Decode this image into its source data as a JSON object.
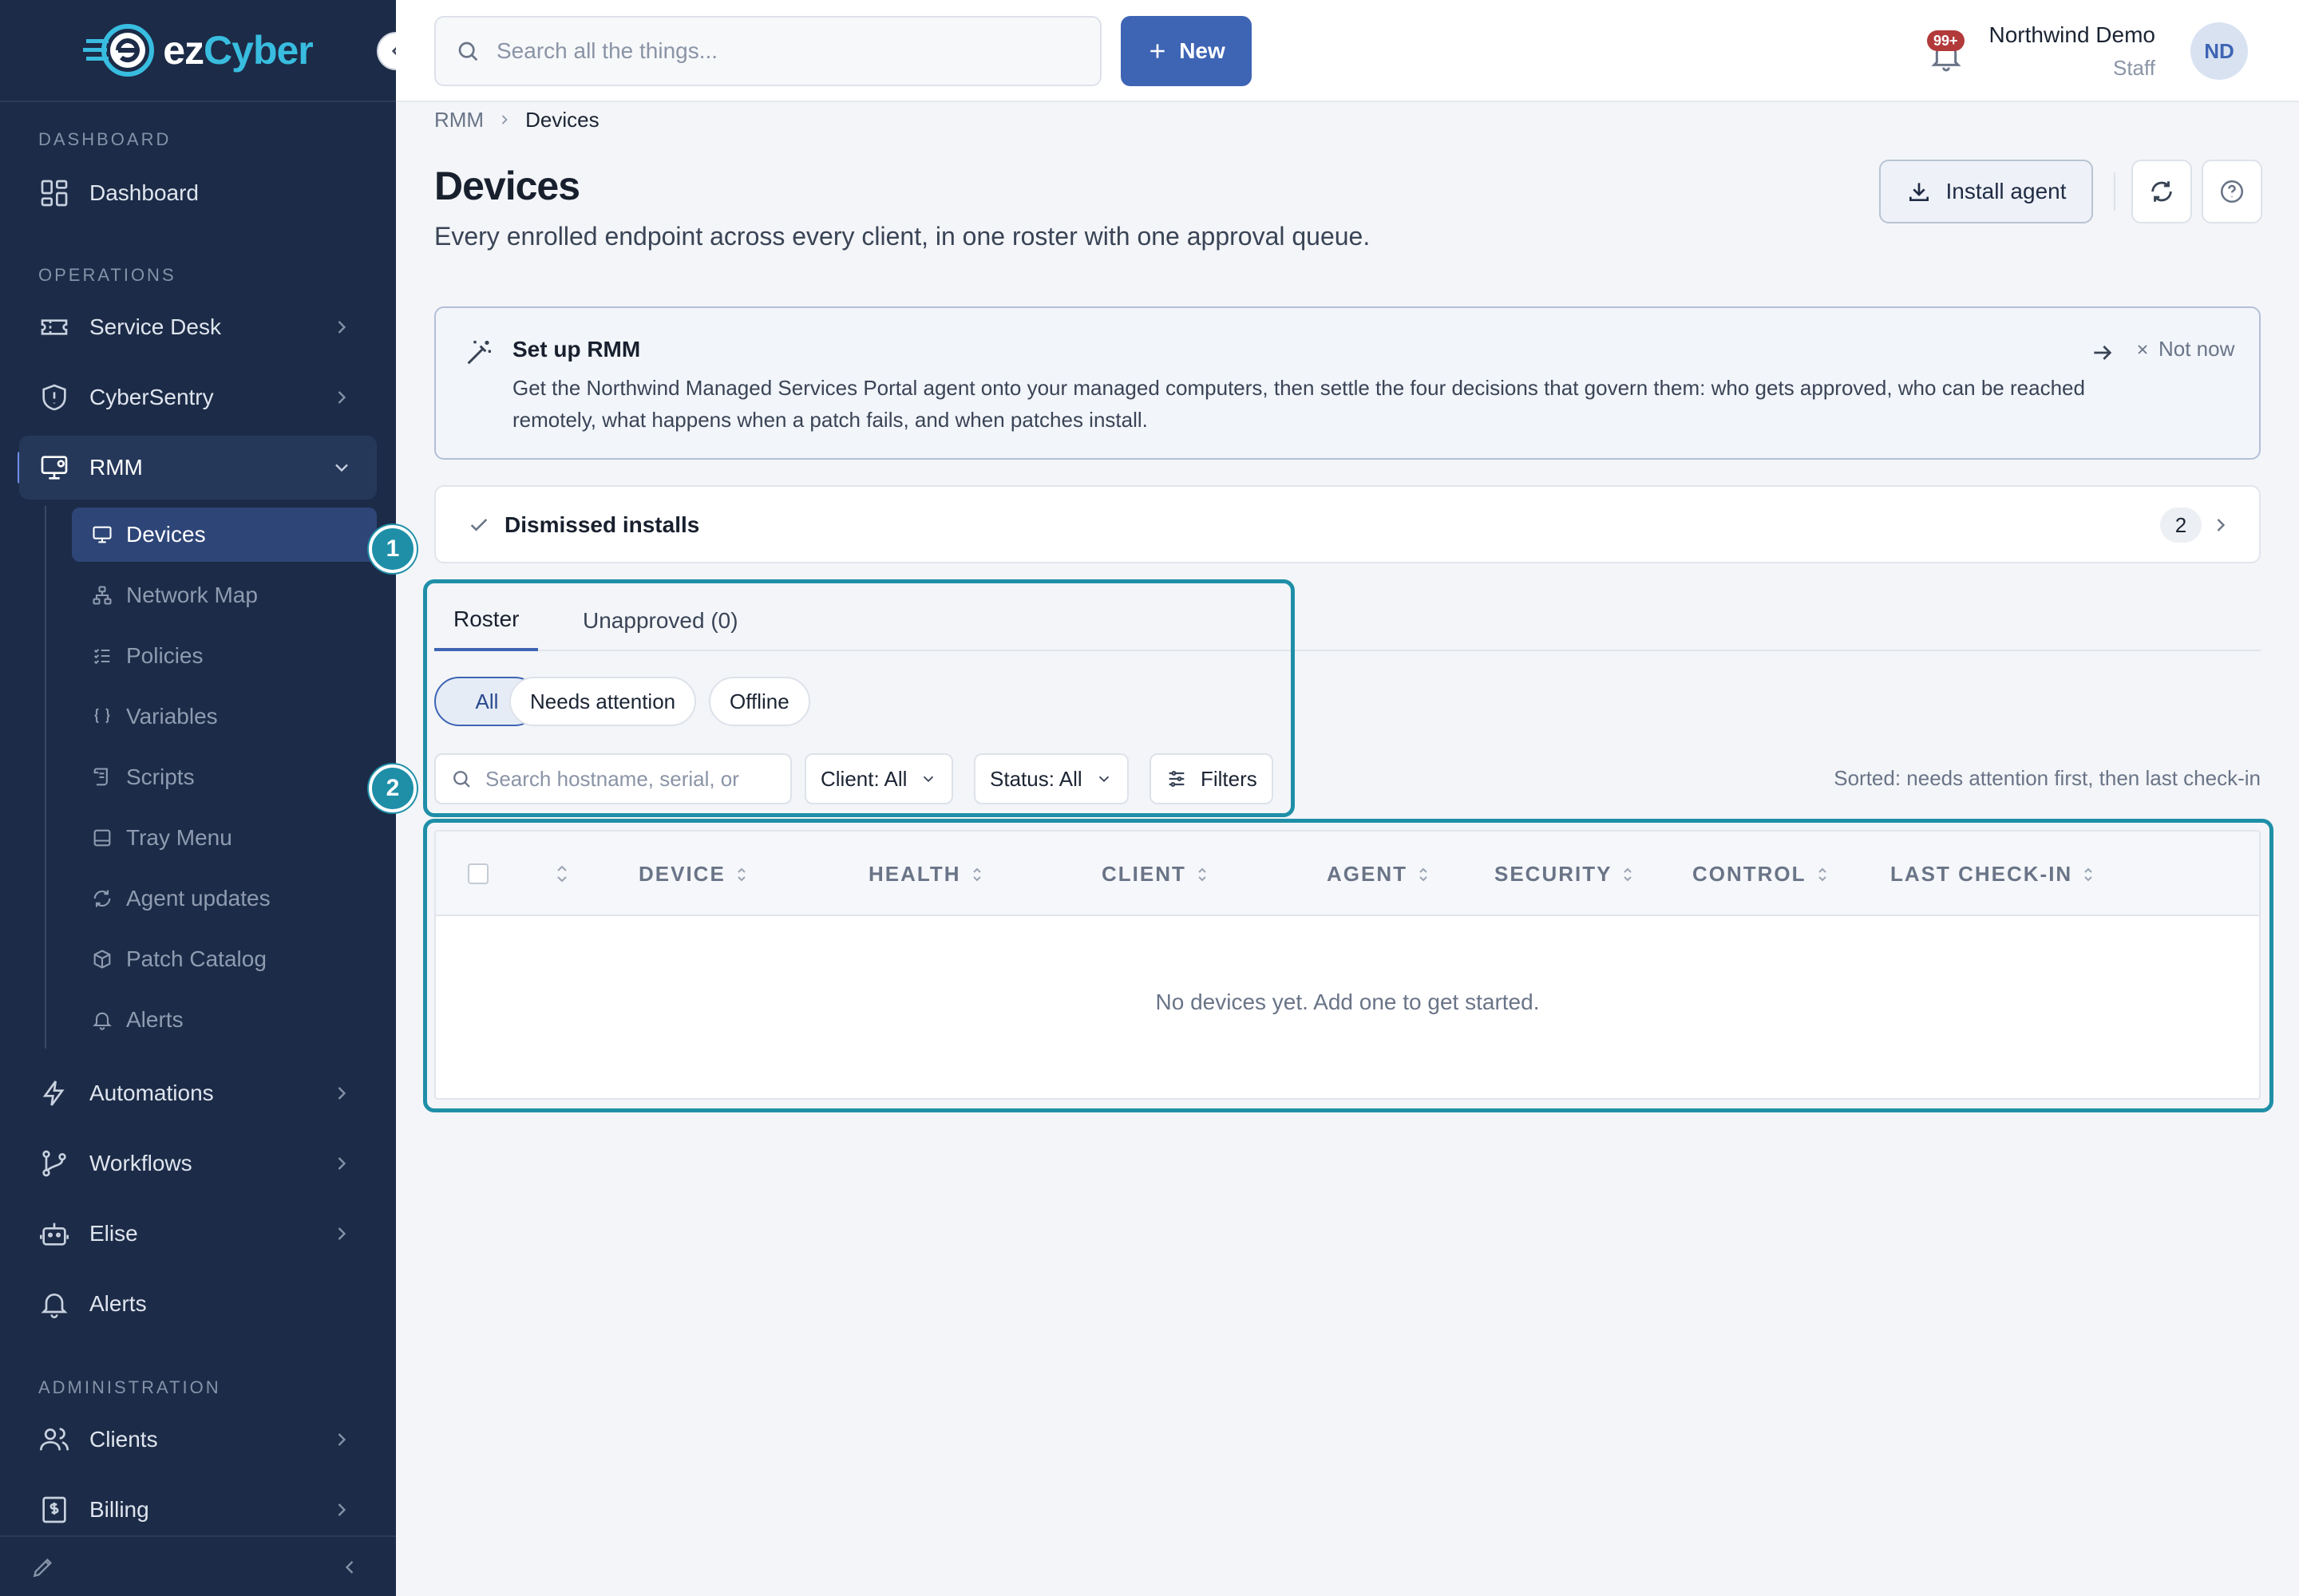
{
  "brand": {
    "logo_prefix": "ez",
    "logo_accent": "Cyber",
    "accent_color": "#38bde0",
    "primary_color": "#3e64b4",
    "sidebar_color": "#1c2b47"
  },
  "sidebar": {
    "sections": {
      "dashboard": "DASHBOARD",
      "operations": "OPERATIONS",
      "administration": "ADMINISTRATION"
    },
    "items": {
      "dashboard": "Dashboard",
      "service_desk": "Service Desk",
      "cybersentry": "CyberSentry",
      "rmm": "RMM",
      "automations": "Automations",
      "workflows": "Workflows",
      "elise": "Elise",
      "alerts": "Alerts",
      "clients": "Clients",
      "billing": "Billing"
    },
    "rmm_sub": {
      "devices": "Devices",
      "network_map": "Network Map",
      "policies": "Policies",
      "variables": "Variables",
      "scripts": "Scripts",
      "tray_menu": "Tray Menu",
      "agent_updates": "Agent updates",
      "patch_catalog": "Patch Catalog",
      "alerts": "Alerts"
    }
  },
  "topbar": {
    "search_placeholder": "Search all the things...",
    "new_label": "New",
    "notification_badge": "99+",
    "user_name": "Northwind Demo",
    "user_role": "Staff",
    "avatar_initials": "ND"
  },
  "breadcrumb": {
    "parent": "RMM",
    "current": "Devices"
  },
  "page": {
    "title": "Devices",
    "subtitle": "Every enrolled endpoint across every client, in one roster with one approval queue.",
    "install_label": "Install agent"
  },
  "setup": {
    "title": "Set up RMM",
    "body": "Get the Northwind Managed Services Portal agent onto your managed computers, then settle the four decisions that govern them: who gets approved, who can be reached remotely, what happens when a patch fails, and when patches install.",
    "not_now": "Not now"
  },
  "dismissed": {
    "label": "Dismissed installs",
    "count": "2"
  },
  "tabs": {
    "roster": "Roster",
    "unapproved": "Unapproved (0)"
  },
  "chips": {
    "all": "All",
    "needs_attention": "Needs attention",
    "offline": "Offline"
  },
  "filters": {
    "search_placeholder": "Search hostname, serial, or",
    "client": "Client: All",
    "status": "Status: All",
    "filters_label": "Filters",
    "sorted_text": "Sorted: needs attention first, then last check-in"
  },
  "table": {
    "columns": [
      "DEVICE",
      "HEALTH",
      "CLIENT",
      "AGENT",
      "SECURITY",
      "CONTROL",
      "LAST CHECK-IN"
    ],
    "empty_message": "No devices yet. Add one to get started."
  },
  "annotations": {
    "one": "1",
    "two": "2"
  }
}
